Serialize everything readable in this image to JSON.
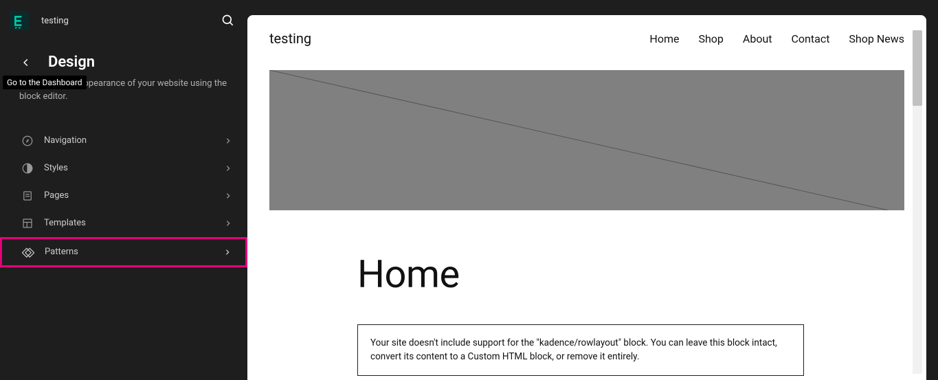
{
  "topbar": {
    "site_name": "testing"
  },
  "panel": {
    "title": "Design",
    "tooltip": "Go to the Dashboard",
    "description": "Customize the appearance of your website using the block editor."
  },
  "menu": {
    "items": [
      {
        "label": "Navigation"
      },
      {
        "label": "Styles"
      },
      {
        "label": "Pages"
      },
      {
        "label": "Templates"
      },
      {
        "label": "Patterns"
      }
    ]
  },
  "preview": {
    "site_title": "testing",
    "nav": {
      "home": "Home",
      "shop": "Shop",
      "about": "About",
      "contact": "Contact",
      "shop_news": "Shop News"
    },
    "page_title": "Home",
    "notice": "Your site doesn't include support for the \"kadence/rowlayout\" block. You can leave this block intact, convert its content to a Custom HTML block, or remove it entirely."
  }
}
